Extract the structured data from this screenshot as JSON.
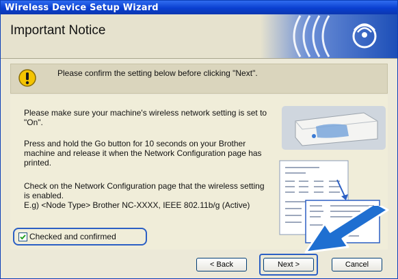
{
  "window": {
    "title": "Wireless Device Setup Wizard"
  },
  "header": {
    "heading": "Important Notice"
  },
  "notice": {
    "text": "Please confirm the setting below before clicking \"Next\"."
  },
  "instructions": {
    "p1": "Please make sure your machine's wireless network setting is set to \"On\".",
    "p2": "Press and hold the Go button for 10 seconds on your Brother machine and release it when the Network Configuration page has printed.",
    "p3_line1": "Check on the Network Configuration page that the wireless setting is enabled.",
    "p3_line2": "E.g) <Node Type> Brother NC-XXXX, IEEE 802.11b/g (Active)"
  },
  "confirm_checkbox": {
    "label": "Checked and confirmed",
    "checked": true
  },
  "buttons": {
    "back": "< Back",
    "next": "Next >",
    "cancel": "Cancel"
  },
  "colors": {
    "titlebar": "#0a3fd0",
    "highlight": "#2b5fc4",
    "warning": "#f2c200",
    "arrow": "#1f6fd1"
  }
}
